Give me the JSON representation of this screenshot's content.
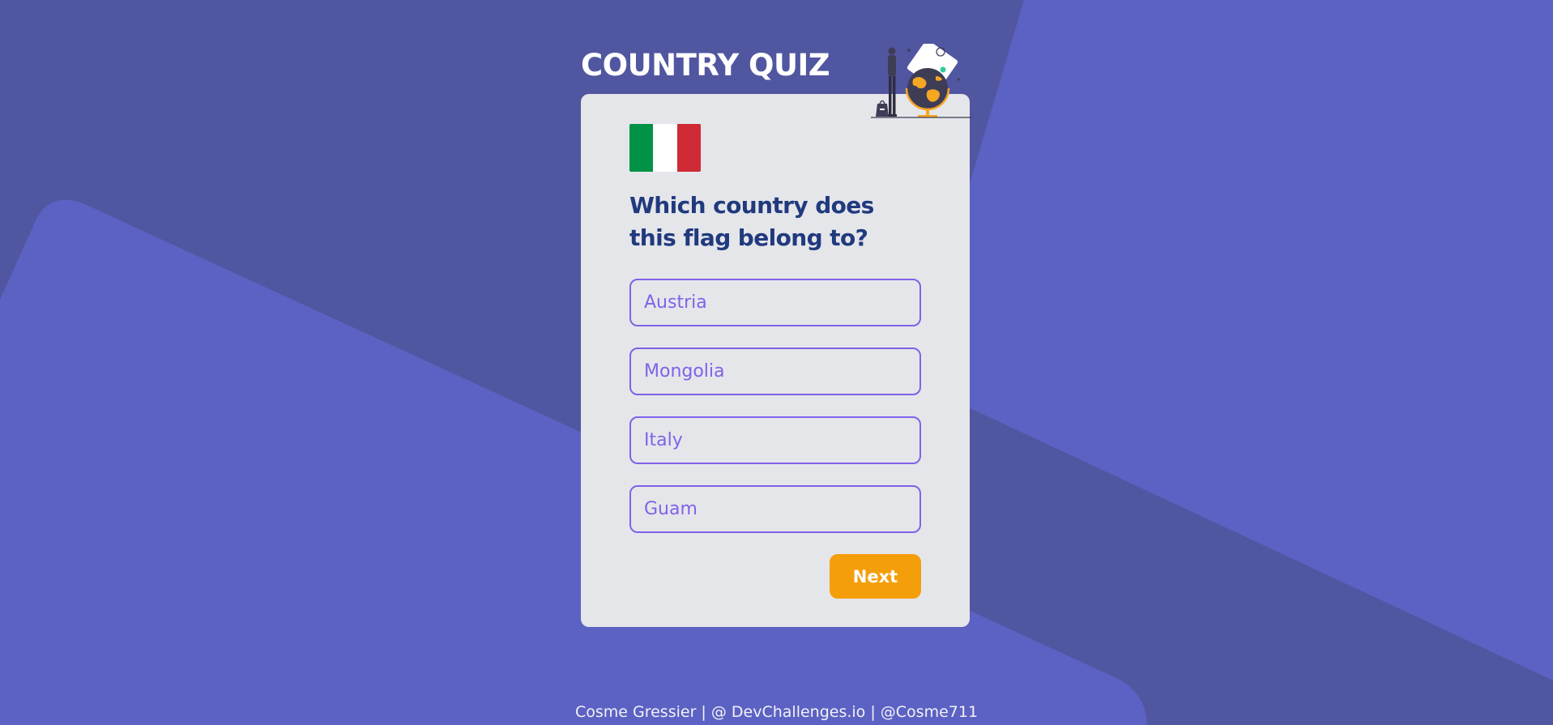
{
  "page": {
    "title": "COUNTRY QUIZ"
  },
  "colors": {
    "background_dark": "#5156a0",
    "background_light": "#5c62c4",
    "card": "#e5e6ea",
    "question_text": "#213a7e",
    "answer_accent": "#8062e8",
    "next_button": "#f59e0b"
  },
  "quiz": {
    "flag": {
      "country": "Italy",
      "stripe_colors": [
        "#009246",
        "#ffffff",
        "#ce2b37"
      ]
    },
    "question": "Which country does this flag belong to?",
    "answers": [
      {
        "label": "Austria"
      },
      {
        "label": "Mongolia"
      },
      {
        "label": "Italy"
      },
      {
        "label": "Guam"
      }
    ],
    "next_label": "Next",
    "illustration_icon": "traveler-globe-icon"
  },
  "footer": {
    "text": "Cosme Gressier | @ DevChallenges.io | @Cosme711"
  }
}
